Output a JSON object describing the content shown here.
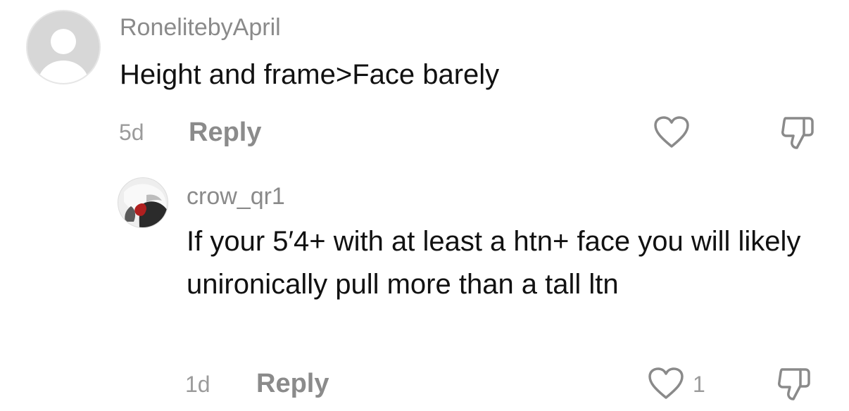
{
  "comments": [
    {
      "username": "RonelitebyApril",
      "text": "Height and frame>Face barely",
      "time": "5d",
      "reply_label": "Reply",
      "like_count": "",
      "avatar_icon": "default-avatar-icon"
    },
    {
      "username": "crow_qr1",
      "text": "If your 5′4+ with at least a htn+ face you will likely unironically pull more than a tall ltn",
      "time": "1d",
      "reply_label": "Reply",
      "like_count": "1",
      "avatar_icon": "profile-photo"
    }
  ],
  "icons": {
    "like": "heart-icon",
    "dislike": "thumbs-down-icon"
  },
  "colors": {
    "text": "#111111",
    "muted": "#8a8a8a",
    "icon": "#8a8a8a",
    "avatar_bg": "#d7d7d7"
  }
}
